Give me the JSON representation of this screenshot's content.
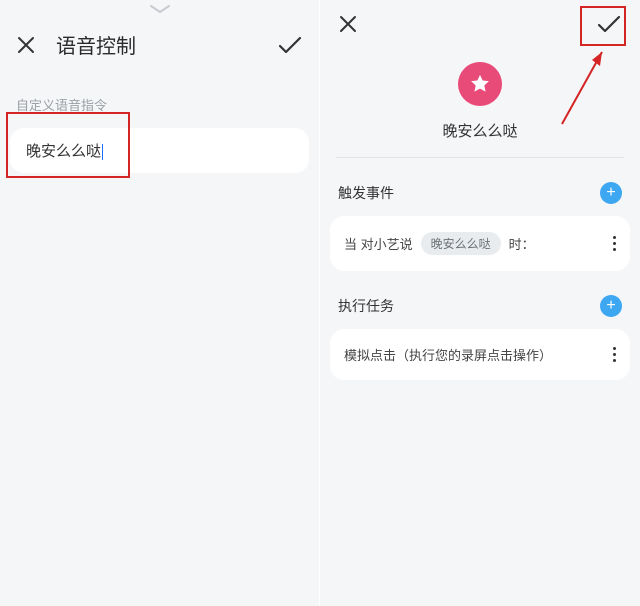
{
  "left": {
    "title": "语音控制",
    "subtitle": "自定义语音指令",
    "command_value": "晚安么么哒"
  },
  "right": {
    "scene_title": "晚安么么哒",
    "trigger": {
      "label": "触发事件",
      "row_prefix": "当 对小艺说",
      "row_chip": "晚安么么哒",
      "row_suffix": "时："
    },
    "tasks": {
      "label": "执行任务",
      "row_text": "模拟点击（执行您的录屏点击操作）"
    }
  },
  "icons": {
    "close": "close-icon",
    "check": "check-icon",
    "chevron_down": "chevron-down-icon",
    "star": "star-icon",
    "plus": "plus-icon",
    "more": "more-vertical-icon"
  }
}
